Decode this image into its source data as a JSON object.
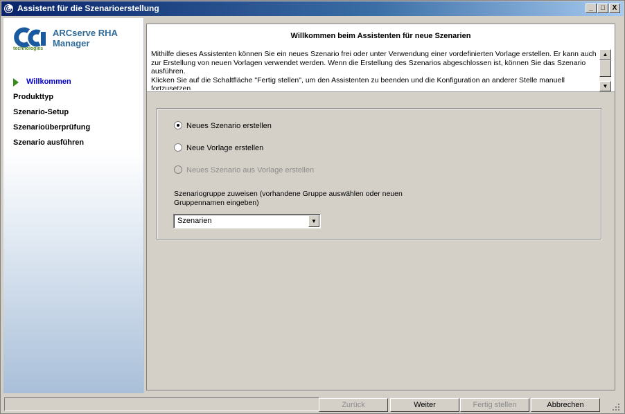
{
  "window": {
    "title": "Assistent für die Szenarioerstellung",
    "controls": {
      "minimize": "_",
      "maximize": "□",
      "close": "X"
    }
  },
  "brand": {
    "logo_text": "ca",
    "logo_sub": "technologies",
    "product_line1": "ARCserve RHA",
    "product_line2": "Manager"
  },
  "nav": {
    "items": [
      {
        "label": "Willkommen",
        "active": true
      },
      {
        "label": "Produkttyp",
        "active": false
      },
      {
        "label": "Szenario-Setup",
        "active": false
      },
      {
        "label": "Szenarioüberprüfung",
        "active": false
      },
      {
        "label": "Szenario ausführen",
        "active": false
      }
    ]
  },
  "header": {
    "title": "Willkommen beim Assistenten für neue Szenarien",
    "text": "Mithilfe dieses Assistenten können Sie ein neues Szenario frei oder unter Verwendung einer vordefinierten Vorlage erstellen. Er kann auch zur Erstellung von neuen Vorlagen verwendet werden. Wenn die Erstellung des Szenarios abgeschlossen ist, können Sie das Szenario ausführen.\nKlicken Sie auf die Schaltfläche \"Fertig stellen\", um den Assistenten zu beenden und die Konfiguration an anderer Stelle manuell fortzusetzen."
  },
  "options": {
    "new_scenario": "Neues Szenario erstellen",
    "new_template": "Neue Vorlage erstellen",
    "from_template": "Neues Szenario aus Vorlage erstellen",
    "selected": "new_scenario"
  },
  "group": {
    "label": "Szenariogruppe zuweisen (vorhandene Gruppe auswählen oder neuen Gruppennamen eingeben)",
    "value": "Szenarien"
  },
  "buttons": {
    "back": "Zurück",
    "next": "Weiter",
    "finish": "Fertig stellen",
    "cancel": "Abbrechen"
  },
  "colors": {
    "title_bar": "#0a246a",
    "product_text": "#2f6b9a",
    "active_nav": "#0000cc",
    "nav_arrow": "#3a8a1a"
  }
}
